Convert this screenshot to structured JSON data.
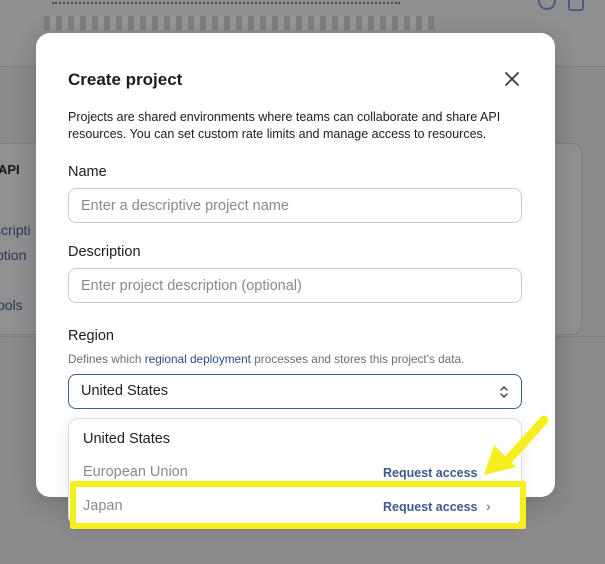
{
  "background": {
    "frag_api": "API",
    "frag_descript": "scripti",
    "frag_option": "ption",
    "frag_tools": "ools"
  },
  "modal": {
    "title": "Create project",
    "description": "Projects are shared environments where teams can collaborate and share API resources. You can set custom rate limits and manage access to resources.",
    "close_icon": "close-icon",
    "name": {
      "label": "Name",
      "placeholder": "Enter a descriptive project name",
      "value": ""
    },
    "description_field": {
      "label": "Description",
      "placeholder": "Enter project description (optional)",
      "value": ""
    },
    "region": {
      "label": "Region",
      "help_before": "Defines which ",
      "help_link": "regional deployment",
      "help_after": " processes and stores this project's data.",
      "selected": "United States",
      "chevron_icon": "chevron-up-down-icon",
      "options": [
        {
          "label": "United States",
          "action": ""
        },
        {
          "label": "European Union",
          "action": "Request access"
        },
        {
          "label": "Japan",
          "action": "Request access",
          "chevron": "›"
        }
      ]
    }
  },
  "annotation": {
    "highlight_color": "#f7ee1e",
    "arrow_icon": "arrow-pointer-icon"
  }
}
